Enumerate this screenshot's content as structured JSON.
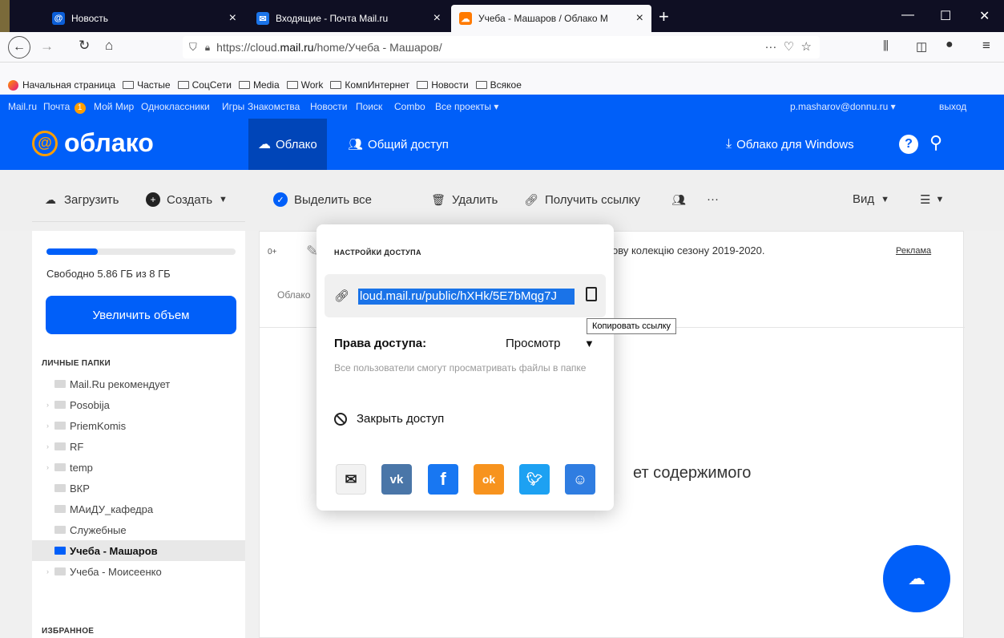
{
  "browser": {
    "tabs": [
      {
        "title": "Новость",
        "favicon_color": "#0b5ed7",
        "favicon_glyph": "@"
      },
      {
        "title": "Входящие - Почта Mail.ru",
        "favicon_color": "#1a73e8",
        "favicon_glyph": "✉"
      },
      {
        "title": "Учеба - Машаров / Облако М",
        "favicon_color": "#ff7a00",
        "favicon_glyph": "☁"
      }
    ],
    "url_prefix": "https://cloud.",
    "url_bold": "mail.ru",
    "url_suffix": "/home/Учеба - Машаров/",
    "bookmarks": [
      "Начальная страница",
      "Частые",
      "СоцСети",
      "Media",
      "Work",
      "КомпИнтернет",
      "Новости",
      "Всякое"
    ]
  },
  "portal": {
    "links": [
      "Mail.ru",
      "Почта",
      "Мой Мир",
      "Одноклассники",
      "Игры",
      "Знакомства",
      "Новости",
      "Поиск",
      "Combo",
      "Все проекты ▾"
    ],
    "mail_count": "1",
    "user": "p.masharov@donnu.ru ▾",
    "logout": "выход"
  },
  "header": {
    "logo_text": "облако",
    "nav_cloud": "Облако",
    "nav_shared": "Общий доступ",
    "windows_app": "Облако для Windows"
  },
  "toolbar": {
    "upload": "Загрузить",
    "create": "Создать",
    "select_all": "Выделить все",
    "delete": "Удалить",
    "get_link": "Получить ссылку",
    "more": "···",
    "view": "Вид"
  },
  "sidebar": {
    "storage_used_fraction": 0.27,
    "free_text": "Свободно 5.86 ГБ из 8 ГБ",
    "enlarge": "Увеличить объем",
    "section_personal": "ЛИЧНЫЕ ПАПКИ",
    "folders": [
      {
        "label": "Mail.Ru рекомендует",
        "expandable": false
      },
      {
        "label": "Posobija",
        "expandable": true
      },
      {
        "label": "PriemKomis",
        "expandable": true
      },
      {
        "label": "RF",
        "expandable": true
      },
      {
        "label": "temp",
        "expandable": true
      },
      {
        "label": "ВКР",
        "expandable": false
      },
      {
        "label": "МАиДУ_кафедра",
        "expandable": false
      },
      {
        "label": "Служебные",
        "expandable": false
      },
      {
        "label": "Учеба - Машаров",
        "expandable": false,
        "active": true
      },
      {
        "label": "Учеба - Моисеенко",
        "expandable": true
      }
    ],
    "section_favorites": "ИЗБРАННОЕ"
  },
  "main": {
    "ad_age": "0+",
    "ad_text": "ову колекцію сезону 2019-2020.",
    "ad_label": "Реклама",
    "crumb": "Облако",
    "empty_text": "ет содержимого"
  },
  "dialog": {
    "title": "НАСТРОЙКИ ДОСТУПА",
    "link": "loud.mail.ru/public/hXHk/5E7bMqg7J",
    "copy_tooltip": "Копировать ссылку",
    "rights_label": "Права доступа:",
    "rights_value": "Просмотр",
    "rights_desc": "Все пользователи смогут просматривать файлы в папке",
    "close_access": "Закрыть доступ",
    "share": [
      {
        "name": "email",
        "color": "#f2f2f2",
        "glyph": "✉"
      },
      {
        "name": "vk",
        "color": "#4a76a8",
        "glyph": "vk"
      },
      {
        "name": "facebook",
        "color": "#1877f2",
        "glyph": "f"
      },
      {
        "name": "odnoklassniki",
        "color": "#f7931e",
        "glyph": "ok"
      },
      {
        "name": "twitter",
        "color": "#1da1f2",
        "glyph": "t"
      },
      {
        "name": "moimir",
        "color": "#2f7de1",
        "glyph": "☺"
      }
    ]
  }
}
